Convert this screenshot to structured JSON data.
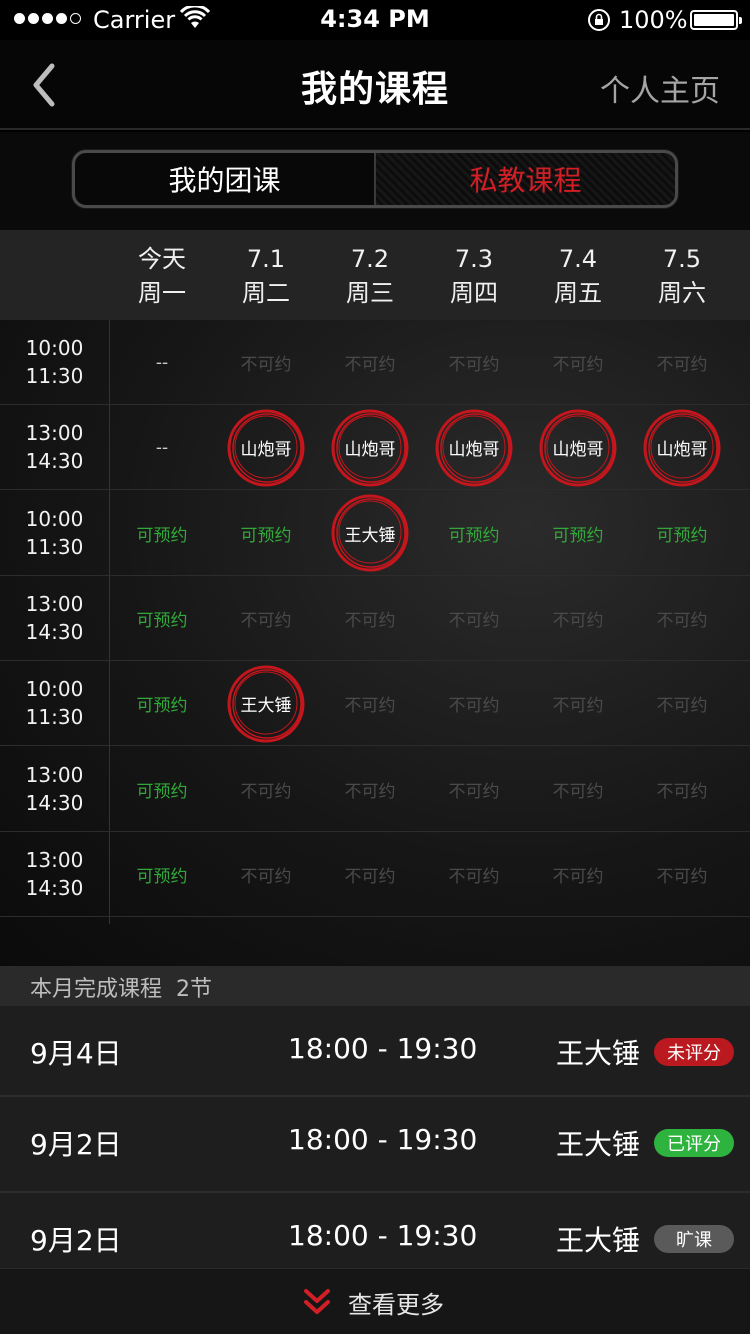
{
  "status_bar": {
    "carrier": "Carrier",
    "time": "4:34 PM",
    "battery": "100%"
  },
  "nav": {
    "title": "我的课程",
    "right_link": "个人主页"
  },
  "tabs": [
    {
      "label": "我的团课",
      "active": false
    },
    {
      "label": "私教课程",
      "active": true
    }
  ],
  "schedule": {
    "days": [
      {
        "date": "今天",
        "weekday": "周一"
      },
      {
        "date": "7.1",
        "weekday": "周二"
      },
      {
        "date": "7.2",
        "weekday": "周三"
      },
      {
        "date": "7.3",
        "weekday": "周四"
      },
      {
        "date": "7.4",
        "weekday": "周五"
      },
      {
        "date": "7.5",
        "weekday": "周六"
      }
    ],
    "rows": [
      {
        "start": "10:00",
        "end": "11:30",
        "cells": [
          "--",
          "不可约",
          "不可约",
          "不可约",
          "不可约",
          "不可约"
        ]
      },
      {
        "start": "13:00",
        "end": "14:30",
        "cells": [
          "--",
          "山炮哥",
          "山炮哥",
          "山炮哥",
          "山炮哥",
          "山炮哥"
        ]
      },
      {
        "start": "10:00",
        "end": "11:30",
        "cells": [
          "可预约",
          "可预约",
          "王大锤",
          "可预约",
          "可预约",
          "可预约"
        ]
      },
      {
        "start": "13:00",
        "end": "14:30",
        "cells": [
          "可预约",
          "不可约",
          "不可约",
          "不可约",
          "不可约",
          "不可约"
        ]
      },
      {
        "start": "10:00",
        "end": "11:30",
        "cells": [
          "可预约",
          "王大锤",
          "不可约",
          "不可约",
          "不可约",
          "不可约"
        ]
      },
      {
        "start": "13:00",
        "end": "14:30",
        "cells": [
          "可预约",
          "不可约",
          "不可约",
          "不可约",
          "不可约",
          "不可约"
        ]
      },
      {
        "start": "13:00",
        "end": "14:30",
        "cells": [
          "可预约",
          "不可约",
          "不可约",
          "不可约",
          "不可约",
          "不可约"
        ]
      }
    ]
  },
  "summary": {
    "label": "本月完成课程",
    "count": "2节",
    "items": [
      {
        "date": "9月4日",
        "time": "18:00 - 19:30",
        "coach": "王大锤",
        "status": "未评分",
        "kind": "unrated"
      },
      {
        "date": "9月2日",
        "time": "18:00 - 19:30",
        "coach": "王大锤",
        "status": "已评分",
        "kind": "rated"
      },
      {
        "date": "9月2日",
        "time": "18:00 - 19:30",
        "coach": "王大锤",
        "status": "旷课",
        "kind": "absent"
      }
    ]
  },
  "more": {
    "label": "查看更多"
  },
  "colors": {
    "accent_red": "#d21f26",
    "available_green": "#33a83a",
    "rated_green": "#2fb33f",
    "unavailable_gray": "#4a4a4a"
  },
  "icons": {
    "back": "chevron-left-icon",
    "more": "double-chevron-down-icon",
    "wifi": "wifi-icon",
    "lock": "rotation-lock-icon",
    "battery": "battery-icon"
  }
}
